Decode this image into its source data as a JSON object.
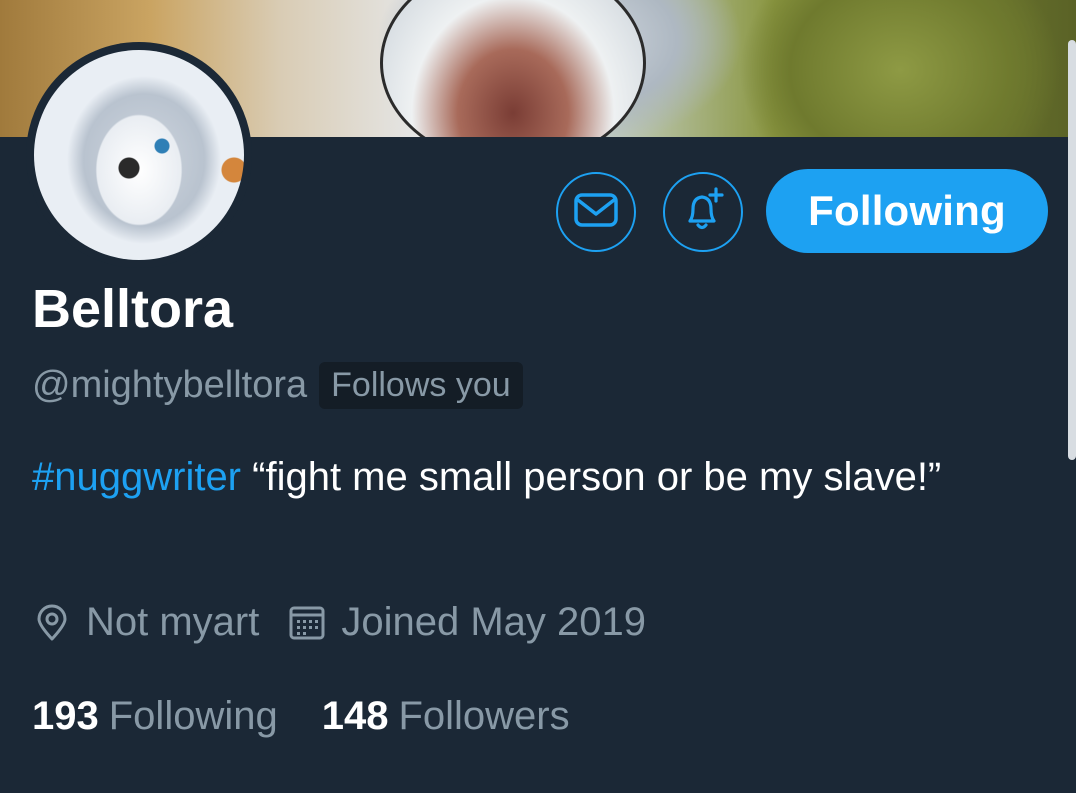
{
  "profile": {
    "display_name": "Belltora",
    "handle": "@mightybelltora",
    "follows_you_badge": "Follows you",
    "bio_hashtag": "#nuggwriter",
    "bio_text": " “fight me small person or be my slave!”",
    "location": "Not myart",
    "joined": "Joined May 2019"
  },
  "actions": {
    "message_icon": "envelope-icon",
    "notify_icon": "bell-plus-icon",
    "follow_label": "Following"
  },
  "stats": {
    "following_count": "193",
    "following_label": "Following",
    "followers_count": "148",
    "followers_label": "Followers"
  },
  "colors": {
    "background": "#1b2836",
    "accent": "#1da1f2",
    "secondary_text": "#8899a6"
  }
}
